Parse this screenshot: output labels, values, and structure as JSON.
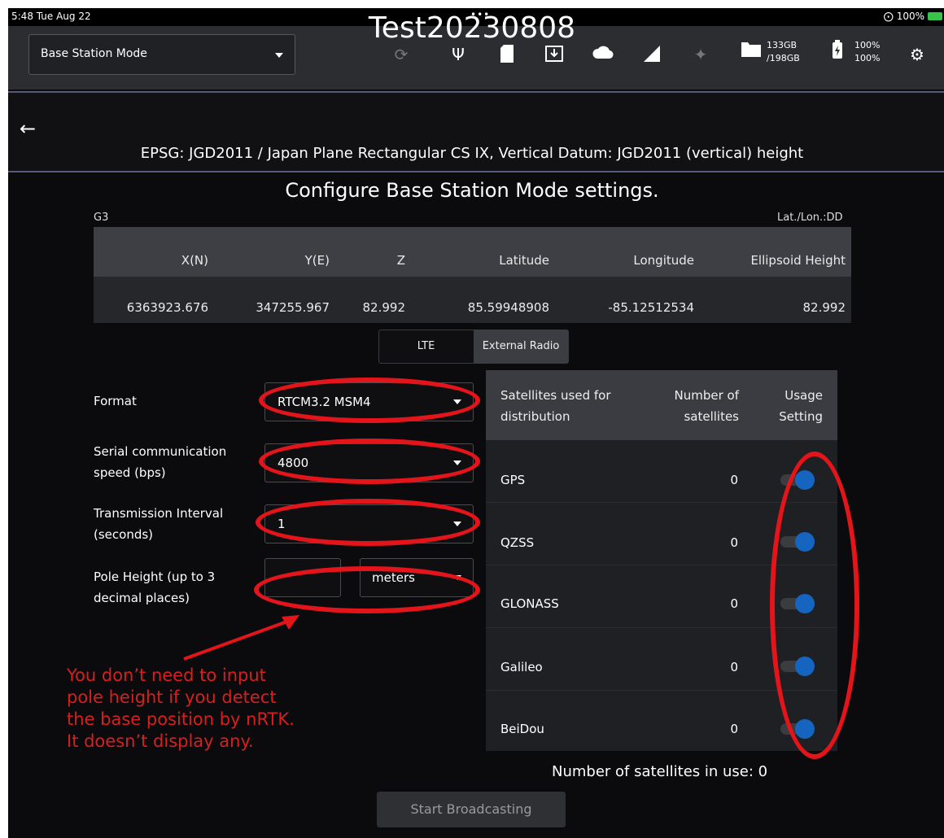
{
  "status_bar": {
    "time": "5:48  Tue Aug 22",
    "dots": "•••",
    "right": "100%"
  },
  "toolbar": {
    "mode": "Base Station Mode",
    "icons": [
      "timer-alert-icon",
      "usb-icon",
      "sd-card-icon",
      "download-icon",
      "cloud-icon",
      "signal-icon",
      "satellite-icon",
      "folder-icon",
      "battery-icon",
      "gear-icon"
    ],
    "storage": {
      "used": "133GB",
      "total": "/198GB"
    },
    "power": {
      "line1": "100%",
      "line2": "100%"
    }
  },
  "header": {
    "title": "Test20230808",
    "subtitle": "EPSG: JGD2011 / Japan Plane Rectangular CS IX, Vertical Datum: JGD2011 (vertical) height"
  },
  "config_title": "Configure Base Station Mode settings.",
  "coords": {
    "label_left": "G3",
    "label_right": "Lat./Lon.:DD",
    "headers": [
      "X(N)",
      "Y(E)",
      "Z",
      "Latitude",
      "Longitude",
      "Ellipsoid Height"
    ],
    "values": [
      "6363923.676",
      "347255.967",
      "82.992",
      "85.59948908",
      "-85.12512534",
      "82.992"
    ]
  },
  "segment": {
    "option_a": "LTE",
    "option_b": "External Radio",
    "selected": "External Radio"
  },
  "form": {
    "format_label": "Format",
    "format_value": "RTCM3.2 MSM4",
    "speed_label_1": "Serial communication",
    "speed_label_2": "speed (bps)",
    "speed_value": "4800",
    "interval_label_1": "Transmission Interval",
    "interval_label_2": "(seconds)",
    "interval_value": "1",
    "pole_label_1": "Pole Height (up to 3",
    "pole_label_2": "decimal places)",
    "pole_value": "",
    "pole_unit": "meters"
  },
  "satellites": {
    "header_name_1": "Satellites used for",
    "header_name_2": "distribution",
    "header_num_1": "Number of",
    "header_num_2": "satellites",
    "header_use_1": "Usage",
    "header_use_2": "Setting",
    "rows": [
      {
        "name": "GPS",
        "count": "0",
        "enabled": true
      },
      {
        "name": "QZSS",
        "count": "0",
        "enabled": true
      },
      {
        "name": "GLONASS",
        "count": "0",
        "enabled": true
      },
      {
        "name": "Galileo",
        "count": "0",
        "enabled": true
      },
      {
        "name": "BeiDou",
        "count": "0",
        "enabled": true
      }
    ],
    "in_use": "Number of satellites in use: 0"
  },
  "start_button": "Start Broadcasting",
  "annotation": {
    "line1": "You don’t need to input",
    "line2": "pole height if you detect",
    "line3": "the base position by nRTK.",
    "line4": "It doesn’t display any.",
    "color": "#e3141a"
  },
  "colors": {
    "accent": "#1565c0",
    "background": "#0b0b0d",
    "toolbar": "#2b2d31"
  }
}
